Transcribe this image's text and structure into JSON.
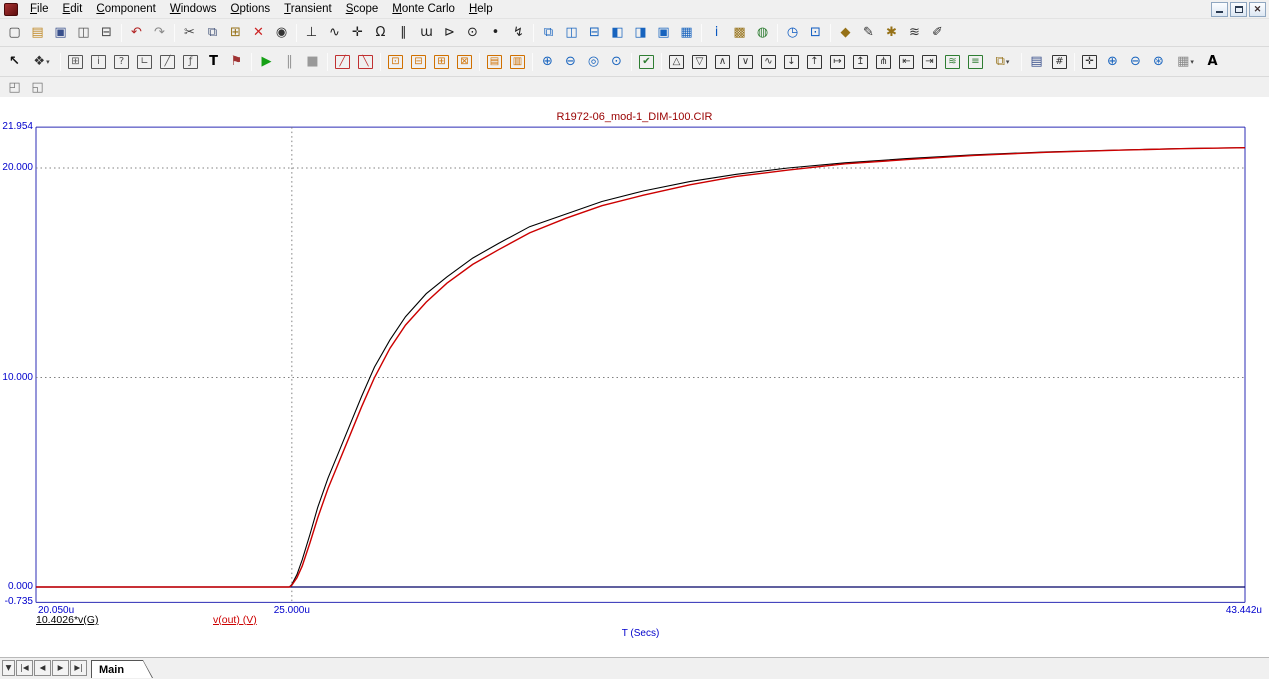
{
  "menu": {
    "items": [
      "File",
      "Edit",
      "Component",
      "Windows",
      "Options",
      "Transient",
      "Scope",
      "Monte Carlo",
      "Help"
    ]
  },
  "window": {
    "close_glyph": "✕"
  },
  "toolbar1": {
    "items": [
      {
        "name": "new-file-button",
        "glyph": "▢",
        "color": "#444444"
      },
      {
        "name": "open-file-button",
        "glyph": "▤",
        "color": "#c08a28"
      },
      {
        "name": "save-file-button",
        "glyph": "▣",
        "color": "#39508c"
      },
      {
        "name": "print-preview-button",
        "glyph": "◫",
        "color": "#555555"
      },
      {
        "name": "print-button",
        "glyph": "⊟",
        "color": "#444444"
      },
      {
        "sep": true
      },
      {
        "name": "undo-button",
        "glyph": "↶",
        "color": "#b22222"
      },
      {
        "name": "redo-button",
        "glyph": "↷",
        "color": "#888888"
      },
      {
        "sep": true
      },
      {
        "name": "cut-button",
        "glyph": "✂",
        "color": "#444444"
      },
      {
        "name": "copy-button",
        "glyph": "⧉",
        "color": "#44547a"
      },
      {
        "name": "paste-button",
        "glyph": "⊞",
        "color": "#967117"
      },
      {
        "name": "delete-button",
        "glyph": "✕",
        "color": "#cc2222"
      },
      {
        "name": "find-button",
        "glyph": "◉",
        "color": "#333333"
      },
      {
        "sep": true
      },
      {
        "name": "ground-component-button",
        "glyph": "⊥",
        "color": "#222222"
      },
      {
        "name": "sine-source-button",
        "glyph": "∿",
        "color": "#222222"
      },
      {
        "name": "wire-cross-button",
        "glyph": "✛",
        "color": "#222222"
      },
      {
        "name": "resistor-button",
        "glyph": "Ω",
        "color": "#222222"
      },
      {
        "name": "capacitor-button",
        "glyph": "∥",
        "color": "#222222"
      },
      {
        "name": "inductor-button",
        "glyph": "ɯ",
        "color": "#222222"
      },
      {
        "name": "diode-button",
        "glyph": "⊳",
        "color": "#222222"
      },
      {
        "name": "transistor-button",
        "glyph": "⊙",
        "color": "#222222"
      },
      {
        "name": "node-dot-button",
        "glyph": "•",
        "color": "#222222"
      },
      {
        "name": "current-source-button",
        "glyph": "↯",
        "color": "#222222"
      },
      {
        "sep": true
      },
      {
        "name": "cascade-windows-button",
        "glyph": "⧉",
        "color": "#1763be"
      },
      {
        "name": "tile-vertical-button",
        "glyph": "◫",
        "color": "#1763be"
      },
      {
        "name": "tile-horizontal-button",
        "glyph": "⊟",
        "color": "#1763be"
      },
      {
        "name": "split-horizontal-button",
        "glyph": "◧",
        "color": "#1763be"
      },
      {
        "name": "split-vertical-button",
        "glyph": "◨",
        "color": "#1763be"
      },
      {
        "name": "maximize-window-button",
        "glyph": "▣",
        "color": "#1763be"
      },
      {
        "name": "calculator-button",
        "glyph": "▦",
        "color": "#1763be"
      },
      {
        "sep": true
      },
      {
        "name": "component-info-button",
        "glyph": "i",
        "color": "#0a58c0"
      },
      {
        "name": "component-editor-button",
        "glyph": "▩",
        "color": "#967117"
      },
      {
        "name": "internet-button",
        "glyph": "◍",
        "color": "#2e7d32"
      },
      {
        "sep": true
      },
      {
        "name": "animate-button",
        "glyph": "◷",
        "color": "#0a58c0"
      },
      {
        "name": "watch-window-button",
        "glyph": "⊡",
        "color": "#0a58c0"
      },
      {
        "sep": true
      },
      {
        "name": "model-editor-button",
        "glyph": "◆",
        "color": "#967117"
      },
      {
        "name": "shape-editor-button",
        "glyph": "✎",
        "color": "#333333"
      },
      {
        "name": "package-editor-button",
        "glyph": "✱",
        "color": "#967117"
      },
      {
        "name": "waveform-button",
        "glyph": "≋",
        "color": "#333333"
      },
      {
        "name": "edit-waveform-button",
        "glyph": "✐",
        "color": "#333333"
      }
    ]
  },
  "toolbar2": {
    "items": [
      {
        "name": "select-mode-button",
        "glyph": "↖",
        "color": "#111111",
        "bold": true
      },
      {
        "name": "component-mode-dropdown",
        "glyph": "❖",
        "color": "#333333",
        "dropdown": true,
        "wide": true
      },
      {
        "sep": true
      },
      {
        "name": "schematic-box-button",
        "glyph": "⊞",
        "box": true,
        "color": "#555555"
      },
      {
        "name": "info-mode-button",
        "glyph": "i",
        "box": true,
        "color": "#555555"
      },
      {
        "name": "help-mode-button",
        "glyph": "?",
        "box": true,
        "color": "#555555"
      },
      {
        "name": "wire-mode-button",
        "glyph": "∟",
        "box": true,
        "color": "#555555"
      },
      {
        "name": "diagonal-wire-button",
        "glyph": "╱",
        "box": true,
        "color": "#555555"
      },
      {
        "name": "formula-text-button",
        "glyph": "ƒ",
        "box": true,
        "color": "#555555"
      },
      {
        "name": "text-mode-button",
        "glyph": "T",
        "color": "#000000",
        "bold": true
      },
      {
        "name": "flag-mode-button",
        "glyph": "⚑",
        "color": "#a03333"
      },
      {
        "sep": true
      },
      {
        "name": "run-button",
        "glyph": "▶",
        "color": "#15a015"
      },
      {
        "name": "pause-button",
        "glyph": "‖",
        "color": "#999999"
      },
      {
        "name": "stop-button",
        "glyph": "■",
        "color": "#999999"
      },
      {
        "sep": true
      },
      {
        "name": "positive-slope-button",
        "glyph": "╱",
        "box": true,
        "color": "#c03030"
      },
      {
        "name": "negative-slope-button",
        "glyph": "╲",
        "box": true,
        "color": "#c03030"
      },
      {
        "sep": true
      },
      {
        "name": "data-points-button",
        "glyph": "⊡",
        "box": true,
        "color": "#d07000"
      },
      {
        "name": "ruler-button",
        "glyph": "⊟",
        "box": true,
        "color": "#d07000"
      },
      {
        "name": "plus-marks-button",
        "glyph": "⊞",
        "box": true,
        "color": "#d07000"
      },
      {
        "name": "tag-mode-button",
        "glyph": "⊠",
        "box": true,
        "color": "#d07000"
      },
      {
        "sep": true
      },
      {
        "name": "horizontal-grids-button",
        "glyph": "▤",
        "box": true,
        "color": "#d07000"
      },
      {
        "name": "vertical-grids-button",
        "glyph": "▥",
        "box": true,
        "color": "#d07000"
      },
      {
        "sep": true
      },
      {
        "name": "zoom-in-button",
        "glyph": "⊕",
        "color": "#1763be"
      },
      {
        "name": "zoom-out-button",
        "glyph": "⊖",
        "color": "#1763be"
      },
      {
        "name": "autoscale-button",
        "glyph": "◎",
        "color": "#1763be"
      },
      {
        "name": "zoom-region-button",
        "glyph": "⊙",
        "color": "#1763be"
      },
      {
        "sep": true
      },
      {
        "name": "properties-button",
        "glyph": "✔",
        "box": true,
        "color": "#2e7d32"
      },
      {
        "sep": true
      },
      {
        "name": "peak-button",
        "glyph": "△",
        "box": true,
        "color": "#333333"
      },
      {
        "name": "valley-button",
        "glyph": "▽",
        "box": true,
        "color": "#333333"
      },
      {
        "name": "high-button",
        "glyph": "∧",
        "box": true,
        "color": "#333333"
      },
      {
        "name": "low-button",
        "glyph": "∨",
        "box": true,
        "color": "#333333"
      },
      {
        "name": "inflection-button",
        "glyph": "∿",
        "box": true,
        "color": "#333333"
      },
      {
        "name": "global-low-button",
        "glyph": "↓",
        "box": true,
        "color": "#333333"
      },
      {
        "name": "global-high-button",
        "glyph": "↑",
        "box": true,
        "color": "#333333"
      },
      {
        "name": "go-to-x-button",
        "glyph": "↦",
        "box": true,
        "color": "#333333"
      },
      {
        "name": "go-to-y-button",
        "glyph": "↥",
        "box": true,
        "color": "#333333"
      },
      {
        "name": "go-to-branch-button",
        "glyph": "⋔",
        "box": true,
        "color": "#333333"
      },
      {
        "name": "cursor-left-button",
        "glyph": "⇤",
        "box": true,
        "color": "#333333"
      },
      {
        "name": "cursor-right-button",
        "glyph": "⇥",
        "box": true,
        "color": "#333333"
      },
      {
        "name": "stacked-plots-button",
        "glyph": "≋",
        "box": true,
        "color": "#2e7d32"
      },
      {
        "name": "overlay-plots-button",
        "glyph": "≡",
        "box": true,
        "color": "#2e7d32"
      },
      {
        "name": "copy-to-clipboard-dropdown",
        "glyph": "⧉",
        "color": "#967117",
        "dropdown": true,
        "wide": true
      },
      {
        "sep": true
      },
      {
        "name": "numeric-output-button",
        "glyph": "▤",
        "color": "#39508c"
      },
      {
        "name": "numeric-values-button",
        "glyph": "#",
        "box": true,
        "color": "#333333"
      },
      {
        "sep": true
      },
      {
        "name": "cursor-mode-button",
        "glyph": "✛",
        "box": true,
        "color": "#333333"
      },
      {
        "name": "scope-zoom-in-button",
        "glyph": "⊕",
        "color": "#1763be"
      },
      {
        "name": "scope-zoom-out-button",
        "glyph": "⊖",
        "color": "#1763be"
      },
      {
        "name": "magnify-region-button",
        "glyph": "⊛",
        "color": "#1763be"
      },
      {
        "name": "grid-pattern-dropdown",
        "glyph": "▦",
        "color": "#888888",
        "dropdown": true,
        "wide": true
      },
      {
        "name": "text-attributes-button",
        "glyph": "A",
        "color": "#000000",
        "bold": true
      }
    ]
  },
  "toolbar3": {
    "items": [
      {
        "name": "bring-to-front-button",
        "glyph": "◰",
        "color": "#777777"
      },
      {
        "name": "send-to-back-button",
        "glyph": "◱",
        "color": "#777777"
      }
    ]
  },
  "chart_data": {
    "type": "line",
    "title": "R1972-06_mod-1_DIM-100.CIR",
    "x_axis_title": "T (Secs)",
    "x_unit": "u (microseconds)",
    "xlim": [
      20.05,
      43.442
    ],
    "ylim": [
      -0.735,
      21.954
    ],
    "grid": true,
    "legend_position": "below-left",
    "y_ticks": [
      {
        "label": "21.954",
        "value": 21.954
      },
      {
        "label": "20.000",
        "value": 20
      },
      {
        "label": "10.000",
        "value": 10
      },
      {
        "label": "0.000",
        "value": 0
      },
      {
        "label": "-0.735",
        "value": -0.735
      }
    ],
    "x_ticks": [
      {
        "label": "20.050u",
        "value": 20.05
      },
      {
        "label": "25.000u",
        "value": 25
      },
      {
        "label": "43.442u",
        "value": 43.442
      }
    ],
    "gridlines": {
      "horizontal_dotted": [
        20,
        10
      ],
      "vertical_dotted": [
        25
      ]
    },
    "series": [
      {
        "name": "10.4026*v(G)",
        "color": "#000000",
        "points": [
          [
            20.05,
            0
          ],
          [
            24.5,
            0
          ],
          [
            24.95,
            0
          ],
          [
            25.0,
            0.12
          ],
          [
            25.1,
            0.6
          ],
          [
            25.2,
            1.3
          ],
          [
            25.35,
            2.5
          ],
          [
            25.5,
            3.8
          ],
          [
            25.7,
            5.2
          ],
          [
            25.9,
            6.4
          ],
          [
            26.1,
            7.6
          ],
          [
            26.35,
            9.1
          ],
          [
            26.6,
            10.5
          ],
          [
            26.9,
            11.8
          ],
          [
            27.2,
            12.9
          ],
          [
            27.6,
            14.0
          ],
          [
            28.0,
            14.8
          ],
          [
            28.5,
            15.7
          ],
          [
            29.0,
            16.4
          ],
          [
            29.6,
            17.2
          ],
          [
            30.3,
            17.8
          ],
          [
            31.0,
            18.4
          ],
          [
            31.8,
            18.9
          ],
          [
            32.7,
            19.35
          ],
          [
            33.6,
            19.7
          ],
          [
            34.6,
            20.0
          ],
          [
            35.7,
            20.25
          ],
          [
            36.9,
            20.45
          ],
          [
            38.2,
            20.63
          ],
          [
            39.6,
            20.77
          ],
          [
            41.0,
            20.86
          ],
          [
            42.2,
            20.93
          ],
          [
            43.442,
            20.97
          ]
        ]
      },
      {
        "name": "v(out) (V)",
        "color": "#cc0000",
        "points": [
          [
            20.05,
            0
          ],
          [
            24.5,
            0
          ],
          [
            24.95,
            0
          ],
          [
            25.0,
            0.08
          ],
          [
            25.1,
            0.45
          ],
          [
            25.2,
            1.0
          ],
          [
            25.35,
            2.1
          ],
          [
            25.5,
            3.3
          ],
          [
            25.7,
            4.7
          ],
          [
            25.9,
            5.9
          ],
          [
            26.1,
            7.1
          ],
          [
            26.35,
            8.6
          ],
          [
            26.6,
            10.0
          ],
          [
            26.9,
            11.4
          ],
          [
            27.2,
            12.5
          ],
          [
            27.6,
            13.6
          ],
          [
            28.0,
            14.5
          ],
          [
            28.5,
            15.4
          ],
          [
            29.0,
            16.1
          ],
          [
            29.6,
            16.9
          ],
          [
            30.3,
            17.6
          ],
          [
            31.0,
            18.2
          ],
          [
            31.8,
            18.7
          ],
          [
            32.7,
            19.2
          ],
          [
            33.6,
            19.6
          ],
          [
            34.6,
            19.9
          ],
          [
            35.7,
            20.2
          ],
          [
            36.9,
            20.4
          ],
          [
            38.2,
            20.6
          ],
          [
            39.6,
            20.75
          ],
          [
            41.0,
            20.85
          ],
          [
            42.2,
            20.92
          ],
          [
            43.442,
            20.97
          ]
        ]
      }
    ]
  },
  "bottom_bar": {
    "page_select_glyph": "▼",
    "nav": [
      {
        "name": "first-page-button",
        "label": "|◀"
      },
      {
        "name": "prev-page-button",
        "label": "◀"
      },
      {
        "name": "next-page-button",
        "label": "▶"
      },
      {
        "name": "last-page-button",
        "label": "▶|"
      }
    ],
    "tab_label": "Main"
  }
}
